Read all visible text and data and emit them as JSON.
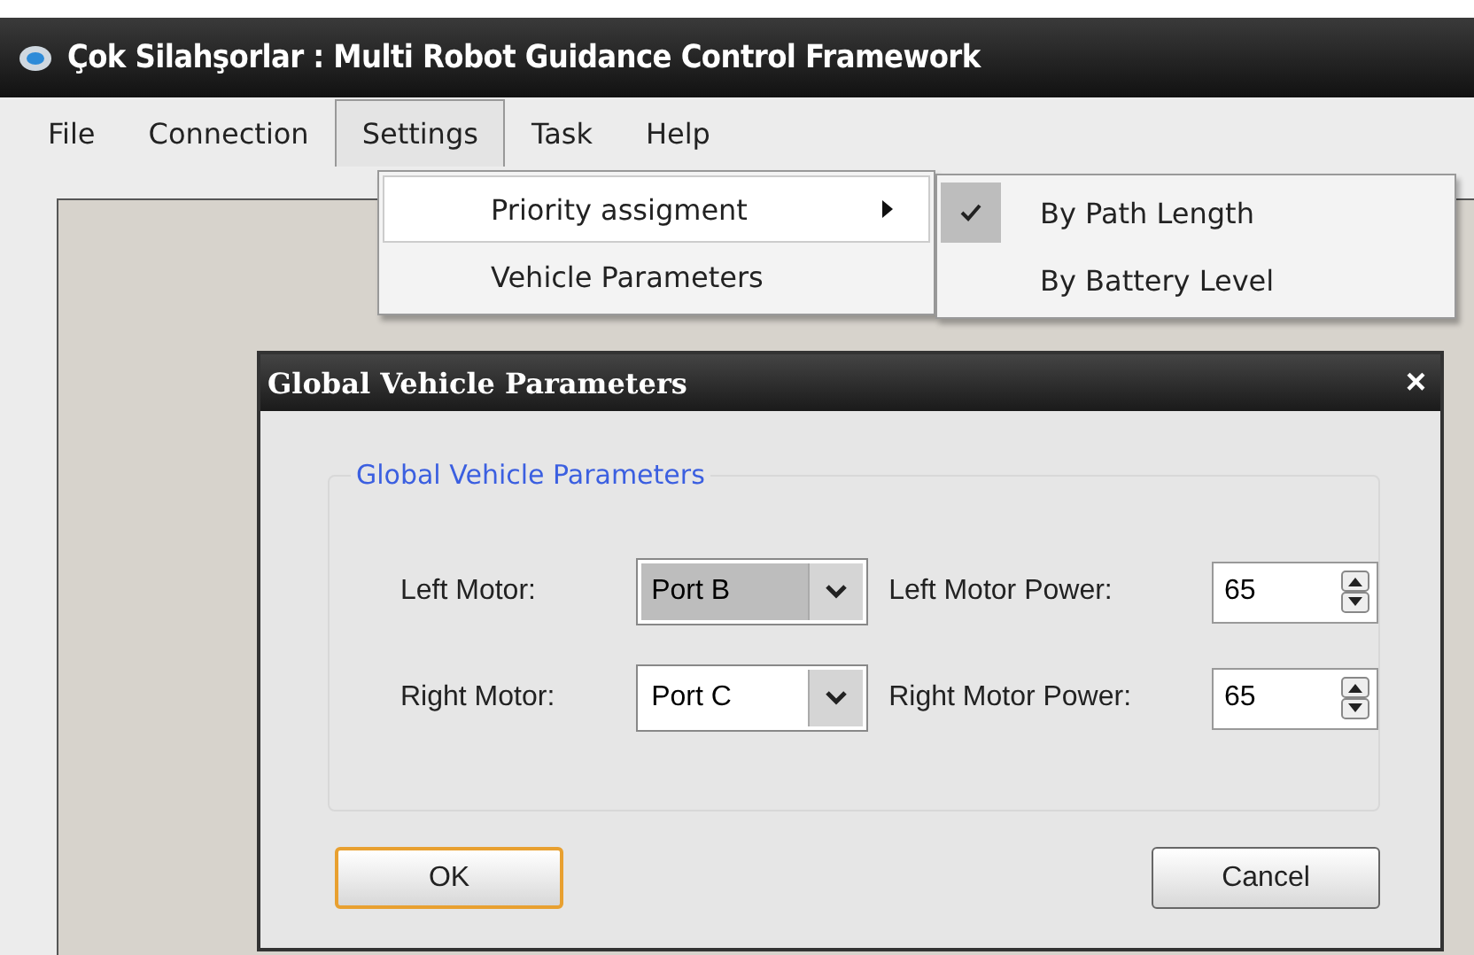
{
  "window": {
    "title": "Çok Silahşorlar : Multi Robot Guidance Control Framework"
  },
  "menu": [
    {
      "label": "File",
      "selected": false
    },
    {
      "label": "Connection",
      "selected": false
    },
    {
      "label": "Settings",
      "selected": true
    },
    {
      "label": "Task",
      "selected": false
    },
    {
      "label": "Help",
      "selected": false
    }
  ],
  "settings_menu": [
    {
      "label": "Priority assigment",
      "submenu": true,
      "highlighted": true
    },
    {
      "label": "Vehicle Parameters",
      "submenu": false,
      "highlighted": false
    }
  ],
  "priority_submenu": [
    {
      "label": "By Path Length",
      "checked": true
    },
    {
      "label": "By Battery Level",
      "checked": false
    }
  ],
  "dialog": {
    "title": "Global Vehicle Parameters",
    "close": "×",
    "group": "Global Vehicle Parameters",
    "fields": [
      {
        "kind": "combo",
        "label": "Left Motor:",
        "value": "Port B",
        "selected": true
      },
      {
        "kind": "spin",
        "label": "Left Motor Power:",
        "value": "65"
      },
      {
        "kind": "combo",
        "label": "Right Motor:",
        "value": "Port C",
        "selected": false
      },
      {
        "kind": "spin",
        "label": "Right Motor Power:",
        "value": "65"
      }
    ],
    "buttons": [
      {
        "label": "OK",
        "default": true
      },
      {
        "label": "Cancel",
        "default": false
      }
    ]
  }
}
